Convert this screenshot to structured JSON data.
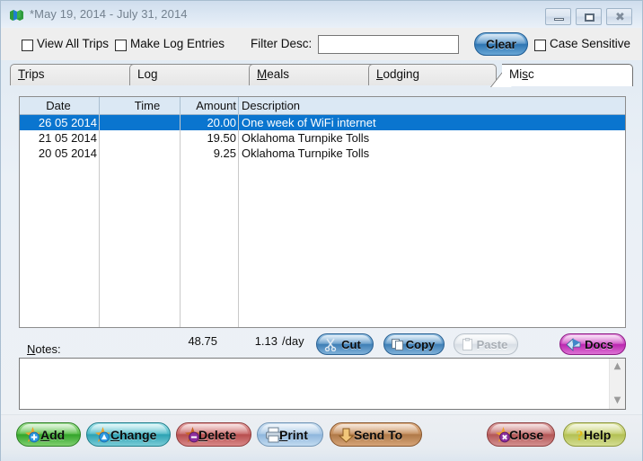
{
  "window": {
    "title": "*May 19, 2014 - July 31, 2014",
    "icon": "map-icon",
    "minimize_label": "–",
    "maximize_label": "□",
    "close_label": "✕"
  },
  "toolbar": {
    "view_all_trips_label": "View All Trips",
    "view_all_trips_checked": false,
    "make_log_entries_label": "Make Log Entries",
    "make_log_entries_checked": false,
    "filter_desc_label": "Filter Desc:",
    "filter_desc_value": "",
    "filter_desc_placeholder": "",
    "clear_label": "Clear",
    "case_sensitive_label": "Case Sensitive",
    "case_sensitive_checked": false
  },
  "tabs": {
    "items": [
      {
        "label": "Trips",
        "accel": "T",
        "active": false
      },
      {
        "label": "Log",
        "accel": "g",
        "active": false
      },
      {
        "label": "Meals",
        "accel": "M",
        "active": false
      },
      {
        "label": "Lodging",
        "accel": "L",
        "active": false
      },
      {
        "label": "Misc",
        "accel": "s",
        "active": true
      }
    ],
    "active_index": 4
  },
  "list": {
    "columns": [
      "Date",
      "Time",
      "Amount",
      "Description"
    ],
    "rows": [
      {
        "date": "26 05 2014",
        "time": "",
        "amount": "20.00",
        "description": "One week of WiFi internet",
        "selected": true
      },
      {
        "date": "21 05 2014",
        "time": "",
        "amount": "19.50",
        "description": "Oklahoma Turnpike Tolls",
        "selected": false
      },
      {
        "date": "20 05 2014",
        "time": "",
        "amount": "9.25",
        "description": "Oklahoma Turnpike Tolls",
        "selected": false
      }
    ],
    "selected_row_color": "#0a75cf",
    "header_color": "#dbe8f4"
  },
  "totals": {
    "total": "48.75",
    "per_day": "1.13",
    "per_day_unit": "/day"
  },
  "clipboard": {
    "cut_label": "Cut",
    "copy_label": "Copy",
    "paste_label": "Paste",
    "paste_disabled": true,
    "docs_label": "Docs"
  },
  "notes": {
    "label": "Notes:",
    "accel": "N",
    "value": "",
    "placeholder": "",
    "scroll_up": "▲",
    "scroll_down": "▼"
  },
  "actions": [
    {
      "label": "Add",
      "accel": "A",
      "icon": "plus-star-icon",
      "color": "#34a52b"
    },
    {
      "label": "Change",
      "accel": "C",
      "icon": "edit-star-icon",
      "color": "#2ea3b4"
    },
    {
      "label": "Delete",
      "accel": "D",
      "icon": "minus-star-icon",
      "color": "#b84f4f"
    },
    {
      "label": "Print",
      "accel": "P",
      "icon": "printer-icon",
      "color": "#8fb7dd"
    },
    {
      "label": "Send To",
      "accel": "",
      "icon": "arrow-out-icon",
      "color": "#b07a49"
    },
    {
      "label": "Close",
      "accel": "",
      "icon": "close-star-icon",
      "color": "#b45757"
    },
    {
      "label": "Help",
      "accel": "",
      "icon": "question-icon",
      "color": "#b4c154"
    }
  ]
}
